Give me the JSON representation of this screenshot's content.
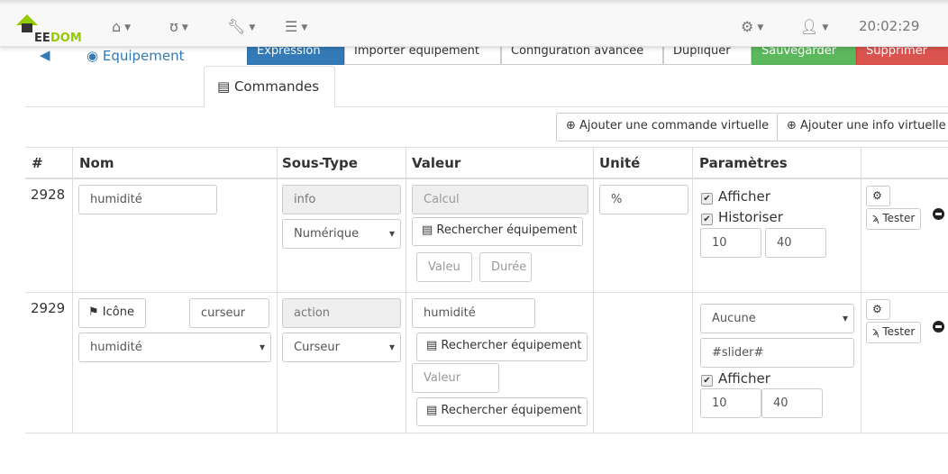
{
  "header": {
    "logo_text_a": "EE",
    "logo_text_b": "DOM",
    "time": "20:02:29",
    "nav_icons": [
      "home-icon",
      "stethoscope-icon",
      "wrench-icon",
      "tasks-icon"
    ],
    "right_icons": [
      "cogs-icon",
      "user-icon"
    ]
  },
  "toolbar": {
    "back_icon": "arrow-circle-left-icon",
    "equipment_tab": "Equipement",
    "expression": "Expression",
    "import": "Importer équipement",
    "advanced": "Configuration avancée",
    "duplicate": "Dupliquer",
    "save": "Sauvegarder",
    "delete": "Supprimer",
    "commands_tab": "Commandes",
    "add_command": "Ajouter une commande virtuelle",
    "add_info": "Ajouter une info virtuelle"
  },
  "colors": {
    "primary": "#337ab7",
    "success": "#5cb85c",
    "danger": "#d9534f",
    "logo_green": "#94ca02"
  },
  "table": {
    "headers": [
      "#",
      "Nom",
      "Sous-Type",
      "Valeur",
      "Unité",
      "Paramètres"
    ],
    "rows": [
      {
        "id": "2928",
        "name": "humidité",
        "type": "info",
        "subtype": "Numérique",
        "value_placeholder": "Calcul",
        "search": "Rechercher équipement",
        "valeur_placeholder": "Valeu",
        "duree_placeholder": "Durée",
        "unit": "%",
        "afficher": "Afficher",
        "historiser": "Historiser",
        "min": "10",
        "max": "40",
        "test": "Tester"
      },
      {
        "id": "2929",
        "icon_btn": "Icône",
        "name": "curseur",
        "parent": "humidité",
        "type": "action",
        "subtype": "Curseur",
        "value": "humidité",
        "search": "Rechercher équipement",
        "valeur_placeholder": "Valeur",
        "search2": "Rechercher équipement",
        "param_select": "Aucune",
        "slider": "#slider#",
        "afficher": "Afficher",
        "min": "10",
        "max": "40",
        "test": "Tester"
      }
    ]
  }
}
